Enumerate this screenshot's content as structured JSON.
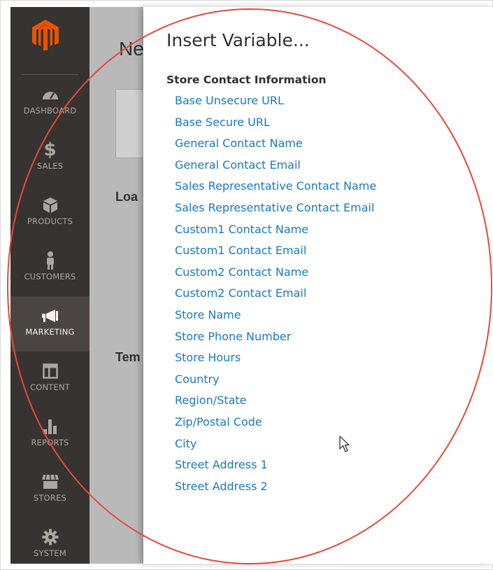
{
  "sidebar": {
    "items": [
      {
        "label": "DASHBOARD",
        "icon": "dashboard-icon",
        "active": false
      },
      {
        "label": "SALES",
        "icon": "dollar-icon",
        "active": false
      },
      {
        "label": "PRODUCTS",
        "icon": "box-icon",
        "active": false
      },
      {
        "label": "CUSTOMERS",
        "icon": "person-icon",
        "active": false
      },
      {
        "label": "MARKETING",
        "icon": "megaphone-icon",
        "active": true
      },
      {
        "label": "CONTENT",
        "icon": "layout-icon",
        "active": false
      },
      {
        "label": "REPORTS",
        "icon": "bar-chart-icon",
        "active": false
      },
      {
        "label": "STORES",
        "icon": "storefront-icon",
        "active": false
      },
      {
        "label": "SYSTEM",
        "icon": "gear-icon",
        "active": false
      }
    ]
  },
  "background_page": {
    "title_fragment": "Ne",
    "load_fragment": "Loa",
    "tem_fragment": "Tem"
  },
  "modal": {
    "title": "Insert Variable...",
    "section_title": "Store Contact Information",
    "variables": [
      "Base Unsecure URL",
      "Base Secure URL",
      "General Contact Name",
      "General Contact Email",
      "Sales Representative Contact Name",
      "Sales Representative Contact Email",
      "Custom1 Contact Name",
      "Custom1 Contact Email",
      "Custom2 Contact Name",
      "Custom2 Contact Email",
      "Store Name",
      "Store Phone Number",
      "Store Hours",
      "Country",
      "Region/State",
      "Zip/Postal Code",
      "City",
      "Street Address 1",
      "Street Address 2"
    ]
  },
  "colors": {
    "sidebar_bg": "#373330",
    "sidebar_active_bg": "#4a4542",
    "logo_orange": "#eb5202",
    "link_blue": "#1979c3",
    "annotation_red": "#e8493a"
  }
}
